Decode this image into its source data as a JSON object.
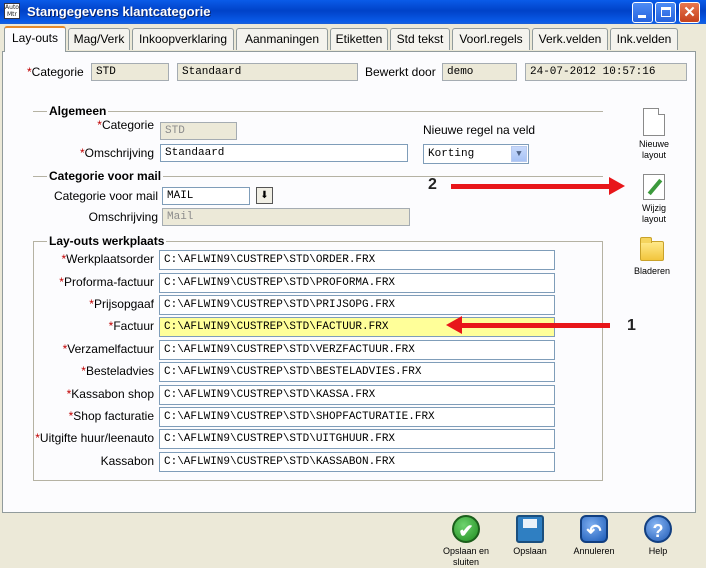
{
  "window": {
    "title": "Stamgegevens klantcategorie",
    "icon_text": "Auto Mtr"
  },
  "tabs": [
    {
      "label": "Lay-outs",
      "active": true
    },
    {
      "label": "Mag/Verk"
    },
    {
      "label": "Inkoopverklaring"
    },
    {
      "label": "Aanmaningen"
    },
    {
      "label": "Etiketten"
    },
    {
      "label": "Std tekst"
    },
    {
      "label": "Voorl.regels"
    },
    {
      "label": "Verk.velden"
    },
    {
      "label": "Ink.velden"
    }
  ],
  "header": {
    "required_mark": "*",
    "categorie_label": "Categorie",
    "categorie_code": "STD",
    "categorie_name": "Standaard",
    "bewerkt_door_label": "Bewerkt door",
    "bewerkt_door_value": "demo",
    "timestamp": "24-07-2012 10:57:16"
  },
  "algemeen": {
    "title": "Algemeen",
    "categorie_label": "Categorie",
    "categorie_value": "STD",
    "omschrijving_label": "Omschrijving",
    "omschrijving_value": "Standaard",
    "nieuwe_regel_label": "Nieuwe regel na veld",
    "nieuwe_regel_value": "Korting"
  },
  "categorie_voor_mail": {
    "title": "Categorie voor mail",
    "categorie_label": "Categorie voor mail",
    "categorie_value": "MAIL",
    "omschrijving_label": "Omschrijving",
    "omschrijving_value": "Mail"
  },
  "layouts": {
    "title": "Lay-outs werkplaats",
    "rows": [
      {
        "label": "Werkplaatsorder",
        "required": true,
        "value": "C:\\AFLWIN9\\CUSTREP\\STD\\ORDER.FRX"
      },
      {
        "label": "Proforma-factuur",
        "required": true,
        "value": "C:\\AFLWIN9\\CUSTREP\\STD\\PROFORMA.FRX"
      },
      {
        "label": "Prijsopgaaf",
        "required": true,
        "value": "C:\\AFLWIN9\\CUSTREP\\STD\\PRIJSOPG.FRX"
      },
      {
        "label": "Factuur",
        "required": true,
        "value": "C:\\AFLWIN9\\CUSTREP\\STD\\FACTUUR.FRX",
        "highlighted": true
      },
      {
        "label": "Verzamelfactuur",
        "required": true,
        "value": "C:\\AFLWIN9\\CUSTREP\\STD\\VERZFACTUUR.FRX"
      },
      {
        "label": "Besteladvies",
        "required": true,
        "value": "C:\\AFLWIN9\\CUSTREP\\STD\\BESTELADVIES.FRX"
      },
      {
        "label": "Kassabon shop",
        "required": true,
        "value": "C:\\AFLWIN9\\CUSTREP\\STD\\KASSA.FRX"
      },
      {
        "label": "Shop facturatie",
        "required": true,
        "value": "C:\\AFLWIN9\\CUSTREP\\STD\\SHOPFACTURATIE.FRX"
      },
      {
        "label": "Uitgifte huur/leenauto",
        "required": true,
        "value": "C:\\AFLWIN9\\CUSTREP\\STD\\UITGHUUR.FRX"
      },
      {
        "label": "Kassabon",
        "required": false,
        "value": "C:\\AFLWIN9\\CUSTREP\\STD\\KASSABON.FRX"
      }
    ]
  },
  "side_buttons": {
    "nieuwe_layout": {
      "label_1": "Nieuwe",
      "label_2": "layout",
      "icon": "new-document-icon"
    },
    "wijzig_layout": {
      "label_1": "Wijzig",
      "label_2": "layout",
      "icon": "edit-document-icon"
    },
    "bladeren": {
      "label": "Bladeren",
      "icon": "folder-icon"
    }
  },
  "bottom_buttons": {
    "opslaan_sluiten": {
      "label_1": "Opslaan en",
      "label_2": "sluiten",
      "icon": "check-icon"
    },
    "opslaan": {
      "label": "Opslaan",
      "icon": "floppy-icon"
    },
    "annuleren": {
      "label": "Annuleren",
      "icon": "undo-icon"
    },
    "help": {
      "label": "Help",
      "icon": "help-icon",
      "glyph": "?"
    }
  },
  "annotations": {
    "one": "1",
    "two": "2"
  },
  "colors": {
    "titlebar": "#0A5BE8",
    "highlight_field": "#FFFF99",
    "required_mark": "#C00000",
    "annotation_arrow": "#E8161A"
  }
}
